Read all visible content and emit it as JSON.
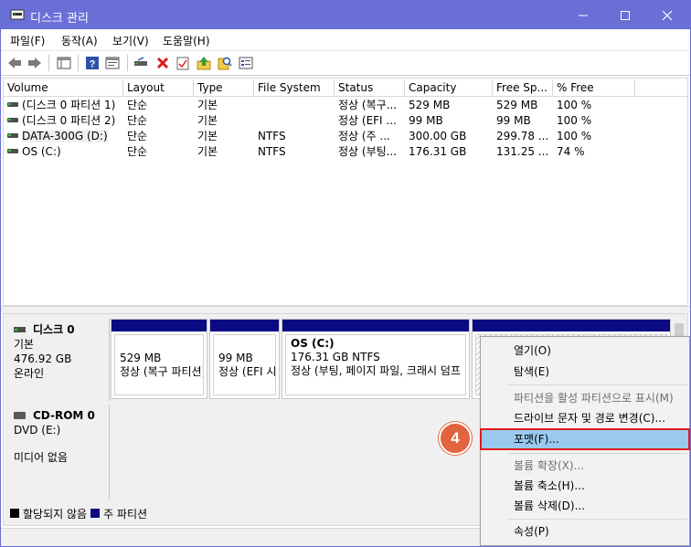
{
  "window": {
    "title": "디스크 관리",
    "titlebar_color": "#6a6fd8",
    "controls": [
      "minimize-icon",
      "maximize-icon",
      "close-icon"
    ]
  },
  "menu": {
    "file": "파일(F)",
    "action": "동작(A)",
    "view": "보기(V)",
    "help": "도움말(H)"
  },
  "toolbar": {
    "icons": [
      "back-arrow-icon",
      "forward-arrow-icon",
      "console-tree-icon",
      "help-icon",
      "properties-icon",
      "connect-drive-icon",
      "delete-icon",
      "check-icon",
      "up-arrow-icon",
      "search-icon",
      "list-icon"
    ]
  },
  "volume_list": {
    "headers": [
      "Volume",
      "Layout",
      "Type",
      "File System",
      "Status",
      "Capacity",
      "Free Sp...",
      "% Free"
    ],
    "rows": [
      {
        "volume": "(디스크 0 파티션 1)",
        "layout": "단순",
        "type": "기본",
        "fs": "",
        "status": "정상 (복구...",
        "capacity": "529 MB",
        "free": "529 MB",
        "pct": "100 %"
      },
      {
        "volume": "(디스크 0 파티션 2)",
        "layout": "단순",
        "type": "기본",
        "fs": "",
        "status": "정상 (EFI ...",
        "capacity": "99 MB",
        "free": "99 MB",
        "pct": "100 %"
      },
      {
        "volume": "DATA-300G (D:)",
        "layout": "단순",
        "type": "기본",
        "fs": "NTFS",
        "status": "정상 (주 ...",
        "capacity": "300.00 GB",
        "free": "299.78 ...",
        "pct": "100 %"
      },
      {
        "volume": "OS (C:)",
        "layout": "단순",
        "type": "기본",
        "fs": "NTFS",
        "status": "정상 (부팅...",
        "capacity": "176.31 GB",
        "free": "131.25 ...",
        "pct": "74 %"
      }
    ]
  },
  "disk0": {
    "name": "디스크 0",
    "type": "기본",
    "size": "476.92 GB",
    "state": "온라인",
    "partitions": [
      {
        "title": "",
        "size": "529 MB",
        "status": "정상 (복구 파티션)"
      },
      {
        "title": "",
        "size": "99 MB",
        "status": "정상 (EFI 시"
      },
      {
        "title": "OS  (C:)",
        "size": "176.31 GB NTFS",
        "status": "정상 (부팅, 페이지 파일, 크래시 덤프"
      },
      {
        "title": "",
        "size": "",
        "status": ""
      }
    ]
  },
  "cdrom": {
    "name": "CD-ROM 0",
    "drive": "DVD (E:)",
    "media": "미디어 없음"
  },
  "legend": {
    "unallocated": "할당되지 않음",
    "primary": "주 파티션",
    "unallocated_color": "#000000",
    "primary_color": "#0a0a82"
  },
  "context_menu": {
    "items": [
      {
        "label": "열기(O)",
        "enabled": true
      },
      {
        "label": "탐색(E)",
        "enabled": true
      },
      {
        "label": "파티션을 활성 파티션으로 표시(M)",
        "enabled": false
      },
      {
        "label": "드라이브 문자 및 경로 변경(C)...",
        "enabled": true
      },
      {
        "label": "포맷(F)...",
        "enabled": true,
        "highlighted": true
      },
      {
        "label": "볼륨 확장(X)...",
        "enabled": false
      },
      {
        "label": "볼륨 축소(H)...",
        "enabled": true
      },
      {
        "label": "볼륨 삭제(D)...",
        "enabled": true
      },
      {
        "label": "속성(P)",
        "enabled": true
      }
    ]
  },
  "annotation": {
    "step": "4",
    "badge_color": "#e1643f",
    "highlight_border_color": "#e01b1b"
  }
}
